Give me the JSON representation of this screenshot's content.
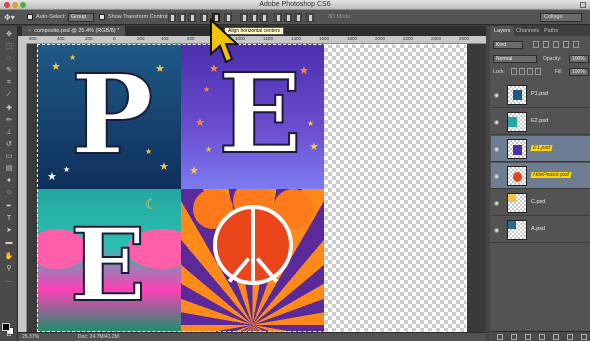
{
  "app": {
    "title": "Adobe Photoshop CS6"
  },
  "options_bar": {
    "auto_select_label": "Auto-Select:",
    "auto_select_value": "Group",
    "show_transform_label": "Show Transform Controls",
    "mode_3d_label": "3D Mode:",
    "workspace_value": "Collage"
  },
  "tooltip": {
    "text": "Align horizontal centers"
  },
  "document": {
    "tab_label": "composite.psd @ 25.4% (RGB/8) *",
    "close_glyph": "×",
    "ruler_ticks": [
      "600",
      "400",
      "200",
      "0",
      "200",
      "400",
      "600",
      "800",
      "1000",
      "1200",
      "1400",
      "1600",
      "1800",
      "2000",
      "2200",
      "2400",
      "2600"
    ]
  },
  "canvas_tiles": {
    "top_left_letter": "P",
    "top_right_letter": "E",
    "bottom_left_letter": "E"
  },
  "status_bar": {
    "zoom": "25.37%",
    "doc_info": "Doc: 24.7M/41.2M"
  },
  "panels": {
    "tabs": [
      "Layers",
      "Channels",
      "Paths"
    ],
    "kind_label": "Kind",
    "blend_mode": "Normal",
    "opacity_label": "Opacity:",
    "opacity_value": "100%",
    "lock_label": "Lock:",
    "fill_label": "Fill:",
    "fill_value": "100%"
  },
  "layers": [
    {
      "name": "P1.psd",
      "highlighted": false,
      "selected": false,
      "thumb_color": "#1f5a86"
    },
    {
      "name": "E2.psd",
      "highlighted": false,
      "selected": false,
      "thumb_color": "#23a6a0"
    },
    {
      "name": "E1.psd",
      "highlighted": true,
      "selected": true,
      "thumb_color": "#4b2fae"
    },
    {
      "name": "HitePeace.psd",
      "highlighted": true,
      "selected": true,
      "thumb_color": "#e9441a"
    },
    {
      "name": "C.psd",
      "highlighted": false,
      "selected": false,
      "thumb_color": "#f2c542"
    },
    {
      "name": "A.psd",
      "highlighted": false,
      "selected": false,
      "thumb_color": "#2a6a8a"
    }
  ],
  "colors": {
    "accent_highlight": "#ffd400",
    "selection": "#6f7d92",
    "tooltip_bg": "#fff8c8"
  }
}
